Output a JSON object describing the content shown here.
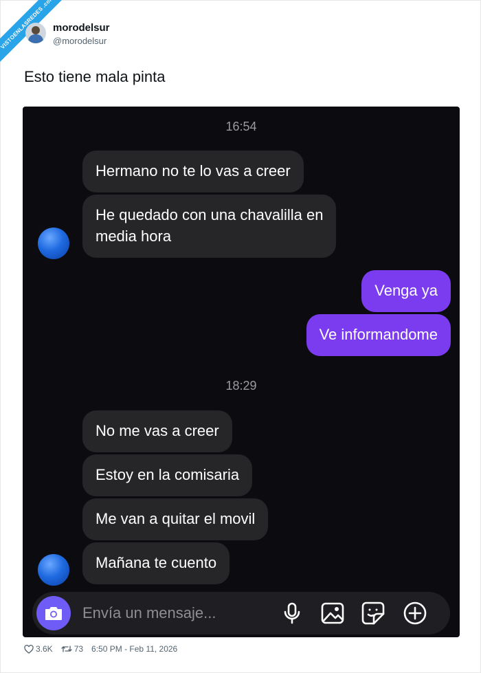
{
  "watermark": "VISTOENLASREDES .com",
  "tweet": {
    "display_name": "morodelsur",
    "handle": "@morodelsur",
    "text": "Esto tiene mala pinta",
    "likes": "3.6K",
    "retweets": "73",
    "timestamp": "6:50 PM - Feb 11, 2026"
  },
  "chat": {
    "timestamps": [
      "16:54",
      "18:29"
    ],
    "messages": [
      {
        "side": "in",
        "text": "Hermano no te lo vas a creer"
      },
      {
        "side": "in",
        "text": "He quedado con una chavalilla en\nmedia hora"
      },
      {
        "side": "out",
        "text": "Venga ya"
      },
      {
        "side": "out",
        "text": "Ve informandome"
      },
      {
        "side": "in",
        "text": "No me vas a creer"
      },
      {
        "side": "in",
        "text": "Estoy en la comisaria"
      },
      {
        "side": "in",
        "text": "Me van a quitar el movil"
      },
      {
        "side": "in",
        "text": "Mañana te cuento"
      }
    ],
    "composer_placeholder": "Envía un mensaje..."
  },
  "colors": {
    "chat_bg": "#0c0c10",
    "incoming_bubble": "#262629",
    "outgoing_bubble": "#7b3cf0",
    "camera_button": "#6f5cf6"
  }
}
